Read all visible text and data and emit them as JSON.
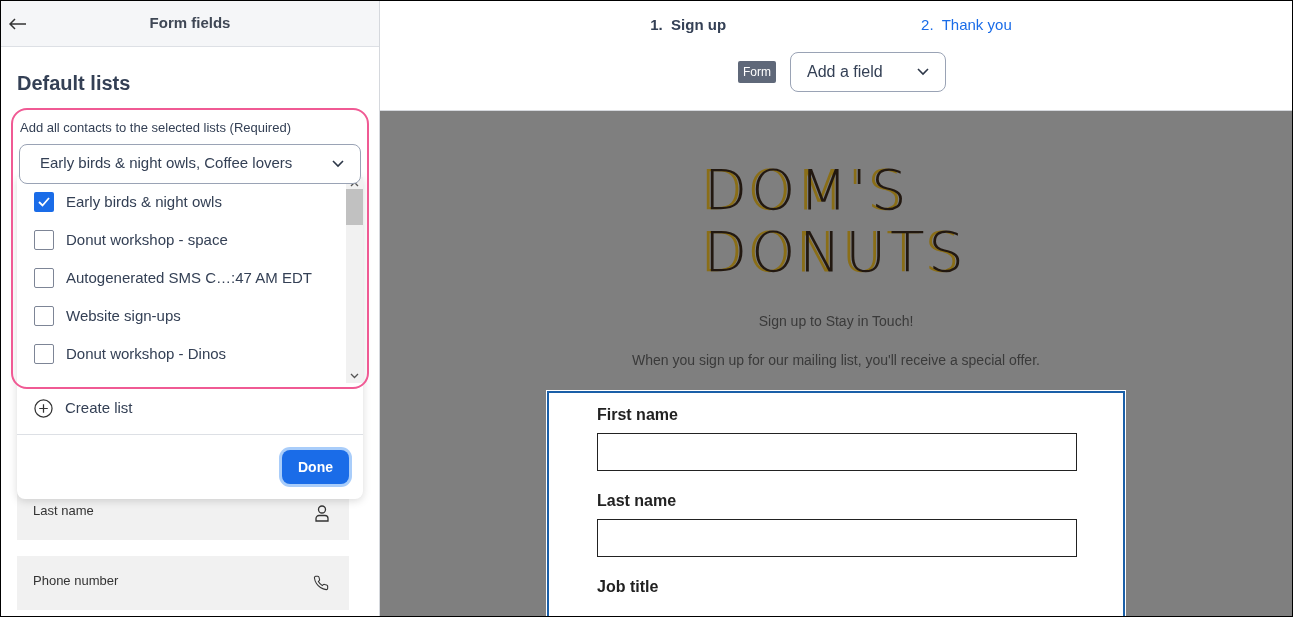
{
  "sidebar": {
    "title": "Form fields",
    "section_title": "Default lists",
    "list_picker": {
      "label": "Add all contacts to the selected lists",
      "required": "(Required)",
      "value": "Early birds & night owls, Coffee lovers",
      "options": [
        {
          "label": "Early birds & night owls",
          "checked": true
        },
        {
          "label": "Donut workshop - space",
          "checked": false
        },
        {
          "label": "Autogenerated SMS C…:47 AM EDT",
          "checked": false
        },
        {
          "label": "Website sign-ups",
          "checked": false
        },
        {
          "label": "Donut workshop - Dinos",
          "checked": false
        }
      ],
      "create_label": "Create list",
      "done_label": "Done"
    },
    "fields": [
      {
        "label": "Last name",
        "kind": "person"
      },
      {
        "label": "Phone number",
        "kind": "phone"
      }
    ]
  },
  "steps": [
    {
      "label": "1.  Sign up",
      "selected": true
    },
    {
      "label": "2.  Thank you",
      "selected": false
    }
  ],
  "toolbar": {
    "badge": "Form",
    "add_field": "Add a field"
  },
  "preview": {
    "logo": [
      "DOM'S",
      "DONUTS"
    ],
    "heading": "Sign up to Stay in Touch!",
    "intro": "When you sign up for our mailing list, you'll receive a special offer.",
    "form_fields": [
      "First name",
      "Last name",
      "Job title"
    ]
  }
}
